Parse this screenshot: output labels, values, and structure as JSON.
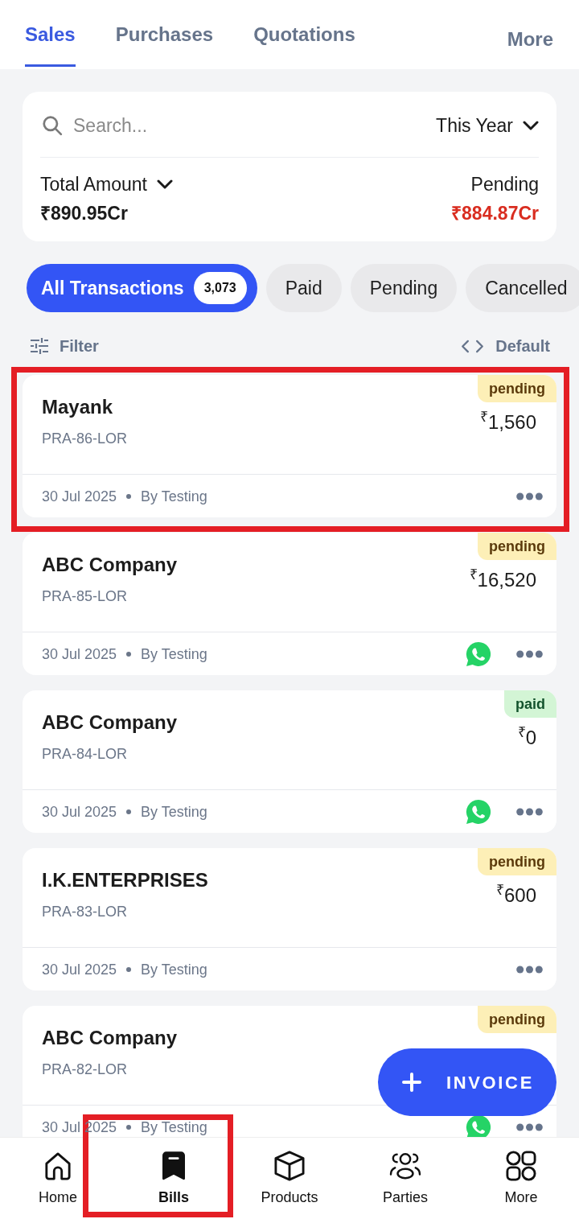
{
  "tabs": [
    {
      "label": "Sales",
      "selected": true
    },
    {
      "label": "Purchases",
      "selected": false
    },
    {
      "label": "Quotations",
      "selected": false
    }
  ],
  "more_button": {
    "label": "More"
  },
  "summary": {
    "search": {
      "placeholder": "Search..."
    },
    "period": "This Year",
    "total": {
      "label": "Total Amount",
      "value": "₹890.95Cr"
    },
    "pending": {
      "label": "Pending",
      "value": "₹884.87Cr"
    }
  },
  "status_chips": [
    {
      "label": "All Transactions",
      "count": "3,073",
      "selected": true
    },
    {
      "label": "Paid",
      "selected": false
    },
    {
      "label": "Pending",
      "selected": false
    },
    {
      "label": "Cancelled",
      "selected": false
    }
  ],
  "list_toolbar": {
    "filter": "Filter",
    "sort": "Default"
  },
  "transactions": [
    {
      "name": "Mayank",
      "number": "PRA-86-LOR",
      "badge": {
        "label": "pending",
        "kind": "pending"
      },
      "amount": "$^{₹}$1,560",
      "date": "30 Jul 2025",
      "by": "By Testing",
      "whatsapp": false,
      "highlighted": true
    },
    {
      "name": "ABC Company",
      "number": "PRA-85-LOR",
      "badge": {
        "label": "pending",
        "kind": "pending"
      },
      "amount": "$^{₹}$16,520",
      "date": "30 Jul 2025",
      "by": "By Testing",
      "whatsapp": true,
      "highlighted": false
    },
    {
      "name": "ABC Company",
      "number": "PRA-84-LOR",
      "badge": {
        "label": "paid",
        "kind": "paid"
      },
      "amount": "$^{₹}$0",
      "date": "30 Jul 2025",
      "by": "By Testing",
      "whatsapp": true,
      "highlighted": false
    },
    {
      "name": "I.K.ENTERPRISES",
      "number": "PRA-83-LOR",
      "badge": {
        "label": "pending",
        "kind": "pending"
      },
      "amount": "$^{₹}$600",
      "date": "30 Jul 2025",
      "by": "By Testing",
      "whatsapp": false,
      "highlighted": false
    },
    {
      "name": "ABC Company",
      "number": "PRA-82-LOR",
      "badge": {
        "label": "pending",
        "kind": "pending"
      },
      "date": "30 Jul 2025",
      "by": "By Testing",
      "whatsapp": true,
      "highlighted": false
    }
  ],
  "fab": {
    "label": "INVOICE"
  },
  "nav": [
    {
      "label": "Home",
      "selected": false,
      "highlighted": false
    },
    {
      "label": "Bills",
      "selected": true,
      "highlighted": true
    },
    {
      "label": "Products",
      "selected": false,
      "highlighted": false
    },
    {
      "label": "Parties",
      "selected": false,
      "highlighted": false
    },
    {
      "label": "More",
      "selected": false,
      "highlighted": false
    }
  ]
}
